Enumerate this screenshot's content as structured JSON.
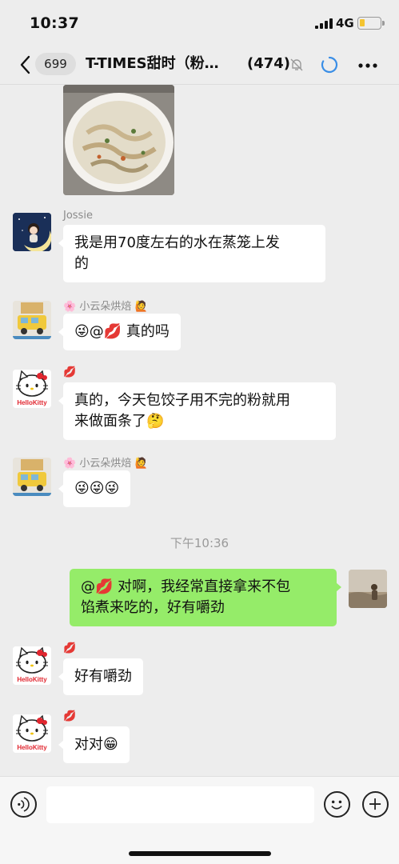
{
  "status_bar": {
    "time": "10:37",
    "network": "4G"
  },
  "nav": {
    "back_count": "699",
    "title": "T-TIMES甜时（粉…",
    "member_count": "(474)"
  },
  "messages": [
    {
      "sender": "Jossie",
      "text_1": "我是用70度左右的水在蒸笼上发",
      "text_2": "的"
    },
    {
      "sender": "🌸 小云朵烘焙 🙋",
      "text": "😜@💋 真的吗"
    },
    {
      "sender": "💋",
      "text_1": "真的，今天包饺子用不完的粉就用",
      "text_2": "来做面条了🤔"
    },
    {
      "sender": "🌸 小云朵烘焙 🙋",
      "text": "😜😜😜"
    },
    {
      "timestamp": "下午10:36"
    },
    {
      "self": true,
      "text_1": "@💋 对啊，我经常直接拿来不包",
      "text_2": "馅煮来吃的，好有嚼劲"
    },
    {
      "sender": "💋",
      "text": "好有嚼劲"
    },
    {
      "sender": "💋",
      "text": "对对😁"
    }
  ],
  "avatars": {
    "kitty_label": "HelloKitty"
  },
  "colors": {
    "self_bubble": "#95ec69",
    "background": "#ededed",
    "accent": "#3a8ee6"
  }
}
